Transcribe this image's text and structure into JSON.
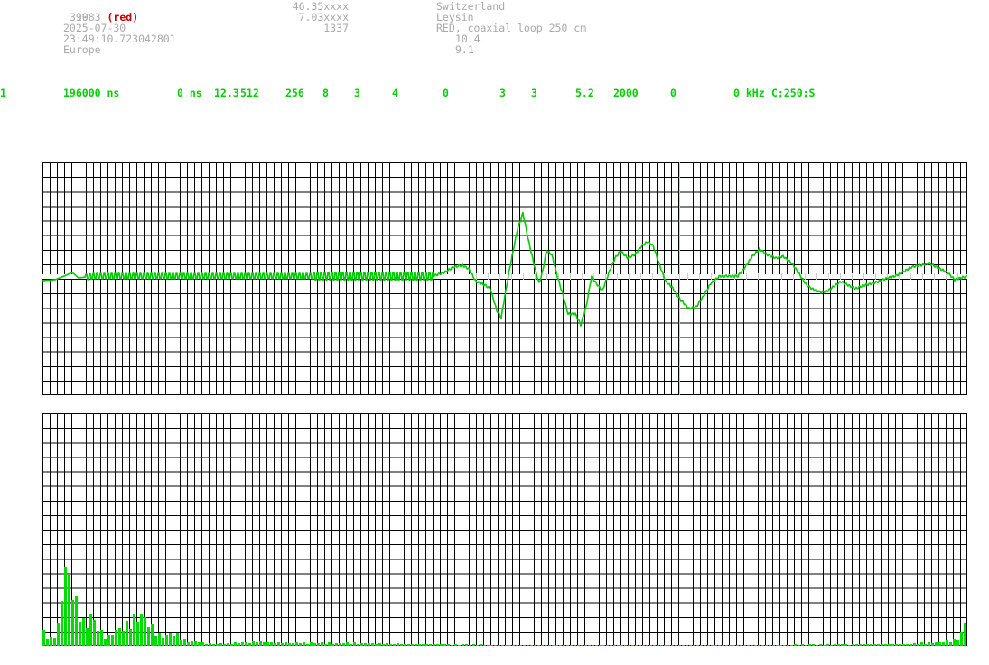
{
  "header": {
    "station_id": "1083",
    "station_tag": "(red)",
    "line2": "399",
    "date": "2025-07-30",
    "time": "23:49:10.723042801",
    "region": "Europe",
    "latitude": "46.35xxxx",
    "longitude": "7.03xxxx",
    "altitude": "1337",
    "country": "Switzerland",
    "city": "Leysin",
    "antenna": "RED, coaxial loop 250 cm",
    "value1": "10.4",
    "value2": "9.1"
  },
  "params": [
    "1",
    "196000 ns",
    "0 ns",
    "12.3",
    "512",
    "256",
    "8",
    "3",
    "4",
    "0",
    "3",
    "3",
    "5.2",
    "2000",
    "0",
    "0 kHz",
    "C;250;S"
  ],
  "colors": {
    "trace": "#00cc00",
    "grid": "#000000",
    "marker": "#99ee99",
    "histogram": "#00dd00"
  }
}
